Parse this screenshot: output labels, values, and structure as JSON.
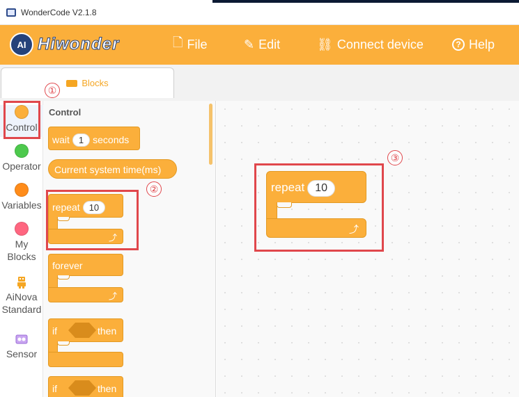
{
  "window": {
    "title": "WonderCode V2.1.8"
  },
  "brand": {
    "logo_text": "Hiwonder",
    "badge": "AI"
  },
  "menu": {
    "file": "File",
    "edit": "Edit",
    "connect": "Connect device",
    "help": "Help",
    "help_icon": "?"
  },
  "tabs": {
    "blocks": "Blocks"
  },
  "categories": [
    {
      "label": "Control",
      "color": "#fbaf3b"
    },
    {
      "label": "Operator",
      "color": "#4dc94d"
    },
    {
      "label": "Variables",
      "color": "#ff8c1a"
    },
    {
      "label_line1": "My",
      "label_line2": "Blocks",
      "color": "#ff6680"
    },
    {
      "label_line1": "AiNova",
      "label_line2": "Standard",
      "icon": "robot-icon"
    },
    {
      "label": "Sensor",
      "icon": "sensor-icon"
    }
  ],
  "palette": {
    "title": "Control",
    "wait": {
      "prefix": "wait",
      "value": "1",
      "suffix": "seconds"
    },
    "system_time": "Current system time(ms)",
    "repeat": {
      "label": "repeat",
      "value": "10"
    },
    "forever": "forever",
    "if_then": {
      "if": "if",
      "then": "then"
    },
    "if_then2": {
      "if": "if",
      "then": "then"
    }
  },
  "workspace": {
    "repeat": {
      "label": "repeat",
      "value": "10"
    }
  },
  "markers": {
    "m1": "①",
    "m2": "②",
    "m3": "③"
  },
  "colors": {
    "accent": "#fbaf3b",
    "highlight": "#e0474c"
  }
}
